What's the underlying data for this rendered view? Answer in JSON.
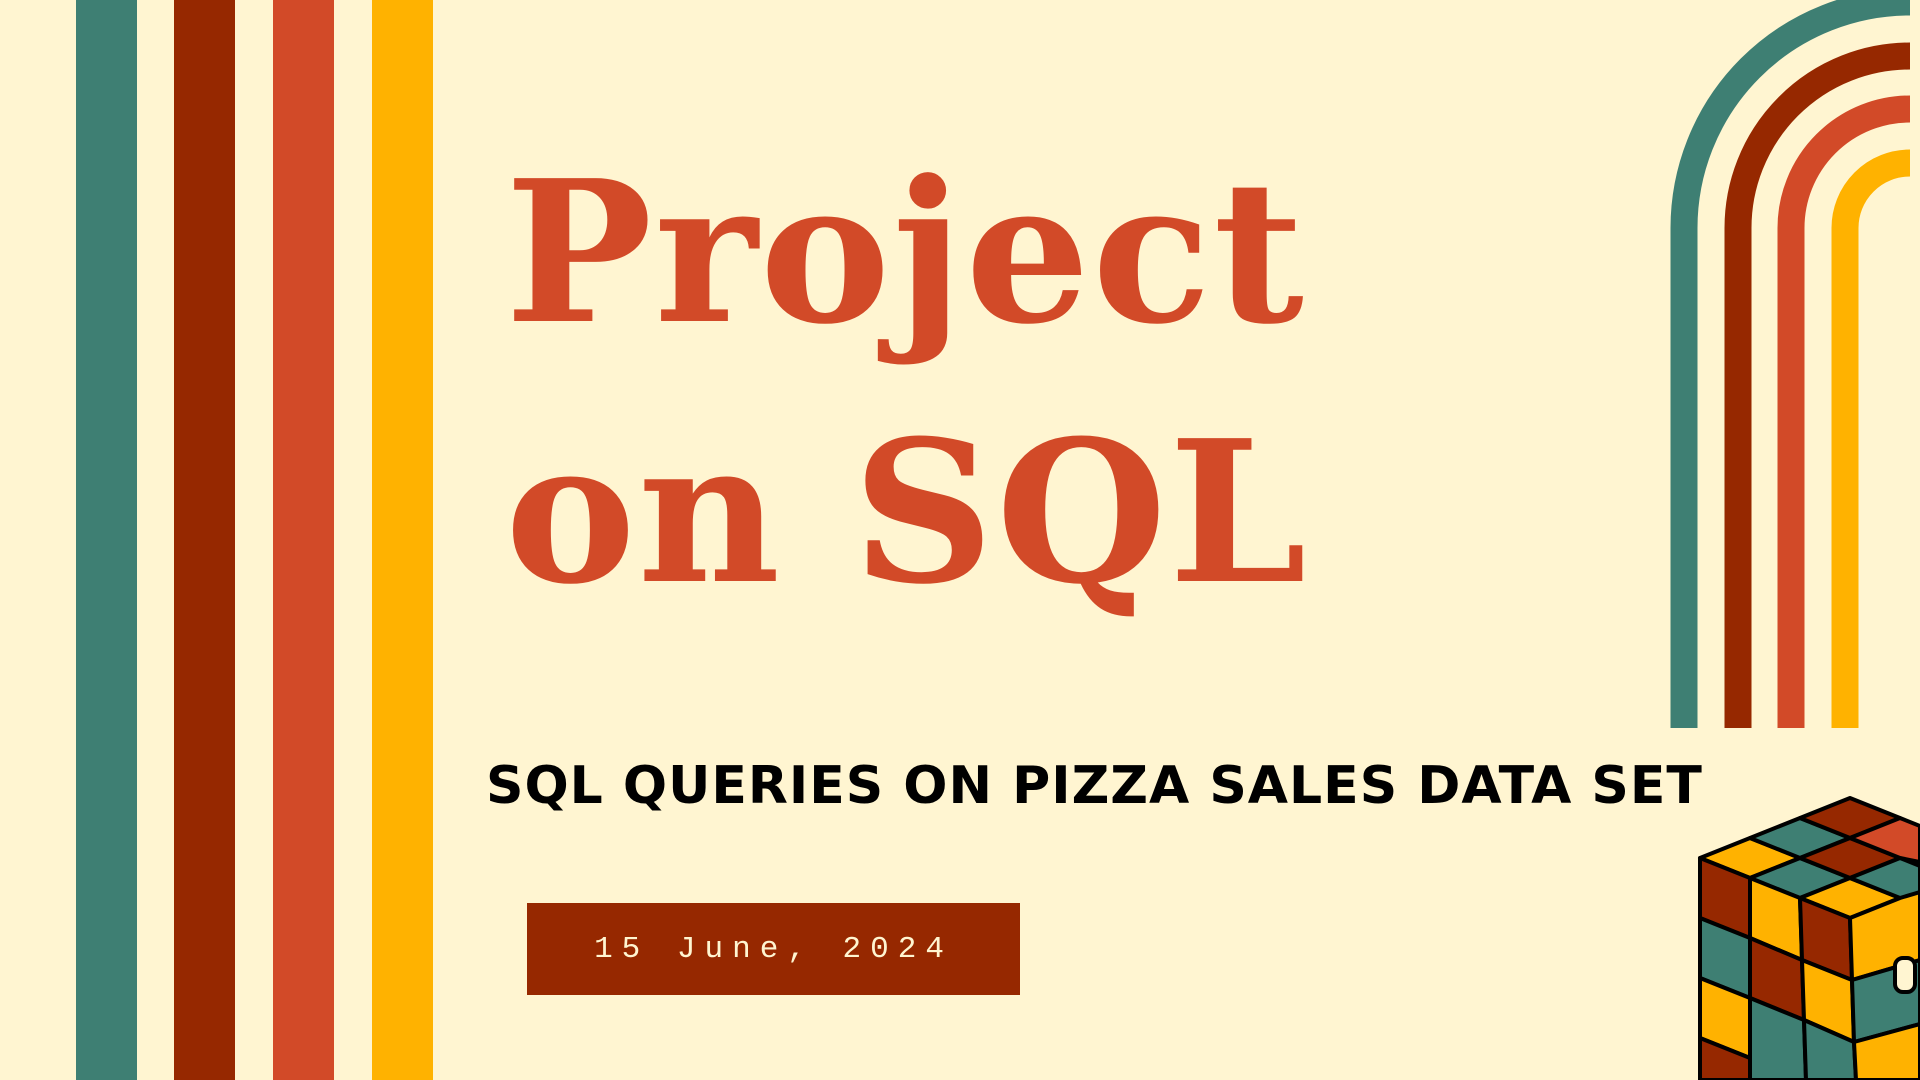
{
  "title": {
    "line1": "Project",
    "line2": "on SQL"
  },
  "subtitle": "SQL QUERIES ON PIZZA SALES DATA SET",
  "date": "15 June, 2024",
  "colors": {
    "background": "#fff5d1",
    "teal": "#3e7f73",
    "maroon": "#962800",
    "orange_red": "#d24a28",
    "amber": "#ffb200",
    "title": "#d24a28",
    "subtitle": "#000000",
    "date_box": "#962800",
    "date_text": "#fff5d1"
  },
  "decorations": {
    "left_stripes": [
      "teal",
      "maroon",
      "orange_red",
      "amber"
    ],
    "top_right": "rainbow-arches",
    "bottom_right": "rubiks-cube-illustration"
  }
}
